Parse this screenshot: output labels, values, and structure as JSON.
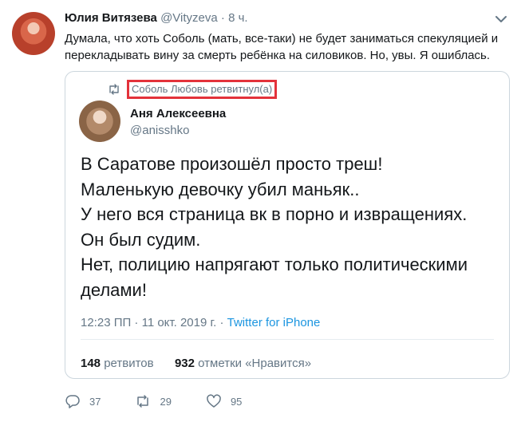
{
  "tweet": {
    "author_name": "Юлия Витязева",
    "author_handle": "@Vityzeva",
    "separator": "·",
    "time": "8 ч.",
    "text": "Думала, что хоть Соболь (мать, все-таки) не будет заниматься спекуляцией и перекладывать вину за смерть ребёнка на силовиков. Но, увы. Я ошиблась."
  },
  "quoted": {
    "retweet_note": "Соболь Любовь ретвитнул(а)",
    "author_name": "Аня Алексеевна",
    "author_handle": "@anisshko",
    "lines": [
      "В Саратове произошёл просто треш!",
      "Маленькую девочку убил маньяк..",
      "У него вся страница вк в порно и извращениях.",
      "Он был судим.",
      "Нет, полицию напрягают только политическими делами!"
    ],
    "timestamp": "12:23 ПП · 11 окт. 2019 г.",
    "meta_separator": "·",
    "source": "Twitter for iPhone",
    "retweets_count": "148",
    "retweets_label": "ретвитов",
    "likes_count": "932",
    "likes_label": "отметки «Нравится»"
  },
  "actions": {
    "replies": "37",
    "retweets": "29",
    "likes": "95"
  },
  "colors": {
    "link": "#1b95e0",
    "highlight_border": "#e3323b",
    "muted": "#657786"
  },
  "icons": [
    "chevron-down-icon",
    "retweet-icon",
    "reply-icon",
    "like-icon"
  ]
}
